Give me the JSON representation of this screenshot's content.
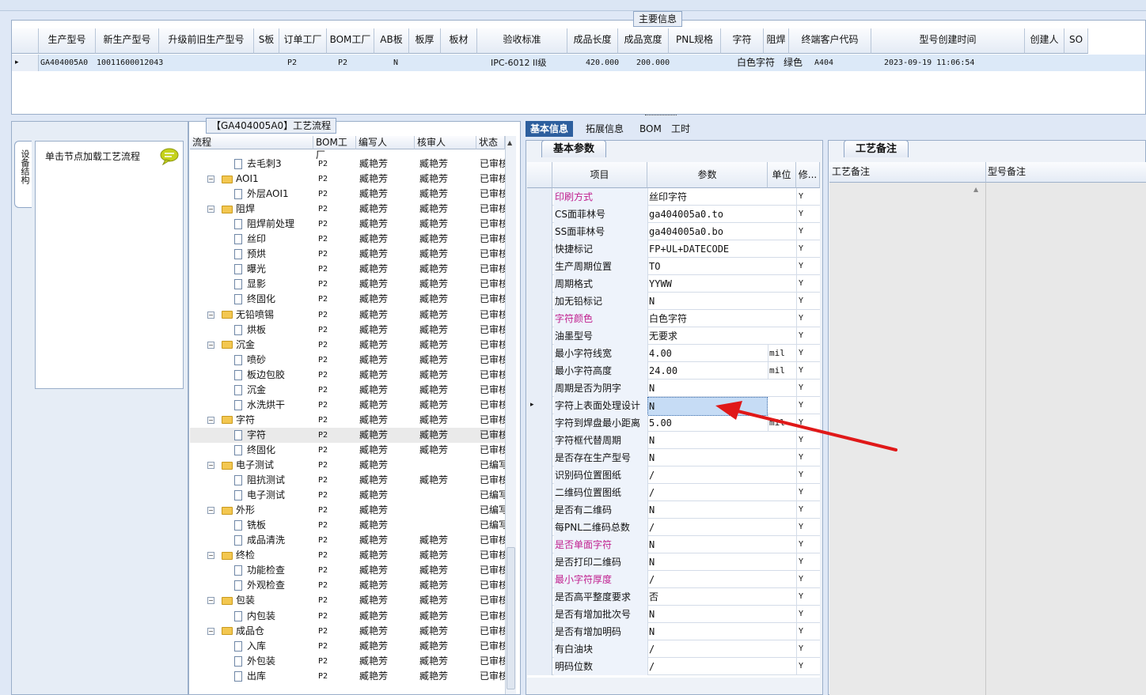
{
  "main_info": {
    "legend": "主要信息",
    "columns": [
      "生产型号",
      "新生产型号",
      "升级前旧生产型号",
      "S板",
      "订单工厂",
      "BOM工厂",
      "AB板",
      "板厚",
      "板材",
      "验收标准",
      "成品长度",
      "成品宽度",
      "PNL规格",
      "字符",
      "阻焊",
      "终端客户代码",
      "型号创建时间",
      "创建人",
      "SO"
    ],
    "row": {
      "model": "GA404005A0",
      "new_model": "10011600012043",
      "order_factory": "P2",
      "bom_factory": "P2",
      "ab_board": "N",
      "standard": "IPC-6012 II级",
      "length": "420.000",
      "width": "200.000",
      "character": "白色字符",
      "solder_mask": "绿色",
      "customer_code": "A404",
      "created": "2023-09-19 11:06:54"
    }
  },
  "left_panel": {
    "vtab_label": "设备结构",
    "hint": "单击节点加载工艺流程"
  },
  "tree": {
    "legend": "【GA404005A0】工艺流程",
    "headers": [
      "流程",
      "BOM工厂",
      "编写人",
      "核审人",
      "状态"
    ],
    "rows": [
      {
        "label": "去毛刺3",
        "level": 2,
        "bom": "P2",
        "writer": "臧艳芳",
        "reviewer": "臧艳芳",
        "status": "已审核"
      },
      {
        "label": "AOI1",
        "level": 1,
        "bom": "P2",
        "writer": "臧艳芳",
        "reviewer": "臧艳芳",
        "status": "已审核"
      },
      {
        "label": "外层AOI1",
        "level": 2,
        "bom": "P2",
        "writer": "臧艳芳",
        "reviewer": "臧艳芳",
        "status": "已审核"
      },
      {
        "label": "阻焊",
        "level": 1,
        "bom": "P2",
        "writer": "臧艳芳",
        "reviewer": "臧艳芳",
        "status": "已审核"
      },
      {
        "label": "阻焊前处理",
        "level": 2,
        "bom": "P2",
        "writer": "臧艳芳",
        "reviewer": "臧艳芳",
        "status": "已审核"
      },
      {
        "label": "丝印",
        "level": 2,
        "bom": "P2",
        "writer": "臧艳芳",
        "reviewer": "臧艳芳",
        "status": "已审核"
      },
      {
        "label": "预烘",
        "level": 2,
        "bom": "P2",
        "writer": "臧艳芳",
        "reviewer": "臧艳芳",
        "status": "已审核"
      },
      {
        "label": "曝光",
        "level": 2,
        "bom": "P2",
        "writer": "臧艳芳",
        "reviewer": "臧艳芳",
        "status": "已审核"
      },
      {
        "label": "显影",
        "level": 2,
        "bom": "P2",
        "writer": "臧艳芳",
        "reviewer": "臧艳芳",
        "status": "已审核"
      },
      {
        "label": "终固化",
        "level": 2,
        "bom": "P2",
        "writer": "臧艳芳",
        "reviewer": "臧艳芳",
        "status": "已审核"
      },
      {
        "label": "无铅喷锡",
        "level": 1,
        "bom": "P2",
        "writer": "臧艳芳",
        "reviewer": "臧艳芳",
        "status": "已审核"
      },
      {
        "label": "烘板",
        "level": 2,
        "bom": "P2",
        "writer": "臧艳芳",
        "reviewer": "臧艳芳",
        "status": "已审核"
      },
      {
        "label": "沉金",
        "level": 1,
        "bom": "P2",
        "writer": "臧艳芳",
        "reviewer": "臧艳芳",
        "status": "已审核"
      },
      {
        "label": "喷砂",
        "level": 2,
        "bom": "P2",
        "writer": "臧艳芳",
        "reviewer": "臧艳芳",
        "status": "已审核"
      },
      {
        "label": "板边包胶",
        "level": 2,
        "bom": "P2",
        "writer": "臧艳芳",
        "reviewer": "臧艳芳",
        "status": "已审核"
      },
      {
        "label": "沉金",
        "level": 2,
        "bom": "P2",
        "writer": "臧艳芳",
        "reviewer": "臧艳芳",
        "status": "已审核"
      },
      {
        "label": "水洗烘干",
        "level": 2,
        "bom": "P2",
        "writer": "臧艳芳",
        "reviewer": "臧艳芳",
        "status": "已审核"
      },
      {
        "label": "字符",
        "level": 1,
        "bom": "P2",
        "writer": "臧艳芳",
        "reviewer": "臧艳芳",
        "status": "已审核"
      },
      {
        "label": "字符",
        "level": 2,
        "bom": "P2",
        "writer": "臧艳芳",
        "reviewer": "臧艳芳",
        "status": "已审核",
        "selected": true
      },
      {
        "label": "终固化",
        "level": 2,
        "bom": "P2",
        "writer": "臧艳芳",
        "reviewer": "臧艳芳",
        "status": "已审核"
      },
      {
        "label": "电子测试",
        "level": 1,
        "bom": "P2",
        "writer": "臧艳芳",
        "reviewer": "",
        "status": "已编写"
      },
      {
        "label": "阻抗测试",
        "level": 2,
        "bom": "P2",
        "writer": "臧艳芳",
        "reviewer": "臧艳芳",
        "status": "已审核"
      },
      {
        "label": "电子测试",
        "level": 2,
        "bom": "P2",
        "writer": "臧艳芳",
        "reviewer": "",
        "status": "已编写"
      },
      {
        "label": "外形",
        "level": 1,
        "bom": "P2",
        "writer": "臧艳芳",
        "reviewer": "",
        "status": "已编写"
      },
      {
        "label": "铣板",
        "level": 2,
        "bom": "P2",
        "writer": "臧艳芳",
        "reviewer": "",
        "status": "已编写"
      },
      {
        "label": "成品清洗",
        "level": 2,
        "bom": "P2",
        "writer": "臧艳芳",
        "reviewer": "臧艳芳",
        "status": "已审核"
      },
      {
        "label": "终检",
        "level": 1,
        "bom": "P2",
        "writer": "臧艳芳",
        "reviewer": "臧艳芳",
        "status": "已审核"
      },
      {
        "label": "功能检查",
        "level": 2,
        "bom": "P2",
        "writer": "臧艳芳",
        "reviewer": "臧艳芳",
        "status": "已审核"
      },
      {
        "label": "外观检查",
        "level": 2,
        "bom": "P2",
        "writer": "臧艳芳",
        "reviewer": "臧艳芳",
        "status": "已审核"
      },
      {
        "label": "包装",
        "level": 1,
        "bom": "P2",
        "writer": "臧艳芳",
        "reviewer": "臧艳芳",
        "status": "已审核"
      },
      {
        "label": "内包装",
        "level": 2,
        "bom": "P2",
        "writer": "臧艳芳",
        "reviewer": "臧艳芳",
        "status": "已审核"
      },
      {
        "label": "成品仓",
        "level": 1,
        "bom": "P2",
        "writer": "臧艳芳",
        "reviewer": "臧艳芳",
        "status": "已审核"
      },
      {
        "label": "入库",
        "level": 2,
        "bom": "P2",
        "writer": "臧艳芳",
        "reviewer": "臧艳芳",
        "status": "已审核"
      },
      {
        "label": "外包装",
        "level": 2,
        "bom": "P2",
        "writer": "臧艳芳",
        "reviewer": "臧艳芳",
        "status": "已审核"
      },
      {
        "label": "出库",
        "level": 2,
        "bom": "P2",
        "writer": "臧艳芳",
        "reviewer": "臧艳芳",
        "status": "已审核"
      }
    ]
  },
  "tabs": [
    "基本信息",
    "拓展信息",
    "BOM",
    "工时"
  ],
  "basic": {
    "subtab": "基本参数",
    "headers": [
      "项目",
      "参数",
      "单位",
      "修..."
    ],
    "rows": [
      {
        "name": "印刷方式",
        "value": "丝印字符",
        "unit": "",
        "mod": "Y",
        "pink": true
      },
      {
        "name": "CS面菲林号",
        "value": "ga404005a0.to",
        "unit": "",
        "mod": "Y",
        "mono": true
      },
      {
        "name": "SS面菲林号",
        "value": "ga404005a0.bo",
        "unit": "",
        "mod": "Y",
        "mono": true
      },
      {
        "name": "快捷标记",
        "value": "FP+UL+DATECODE",
        "unit": "",
        "mod": "Y",
        "mono": true
      },
      {
        "name": "生产周期位置",
        "value": "TO",
        "unit": "",
        "mod": "Y",
        "mono": true
      },
      {
        "name": "周期格式",
        "value": "YYWW",
        "unit": "",
        "mod": "Y",
        "mono": true
      },
      {
        "name": "加无铅标记",
        "value": "N",
        "unit": "",
        "mod": "Y",
        "mono": true
      },
      {
        "name": "字符颜色",
        "value": "白色字符",
        "unit": "",
        "mod": "Y",
        "pink": true
      },
      {
        "name": "油墨型号",
        "value": "无要求",
        "unit": "",
        "mod": "Y"
      },
      {
        "name": "最小字符线宽",
        "value": "4.00",
        "unit": "mil",
        "mod": "Y",
        "mono": true
      },
      {
        "name": "最小字符高度",
        "value": "24.00",
        "unit": "mil",
        "mod": "Y",
        "mono": true
      },
      {
        "name": "周期是否为阴字",
        "value": "N",
        "unit": "",
        "mod": "Y",
        "mono": true
      },
      {
        "name": "字符上表面处理设计",
        "value": "N",
        "unit": "",
        "mod": "Y",
        "mono": true,
        "current": true
      },
      {
        "name": "字符到焊盘最小距离",
        "value": "5.00",
        "unit": "mil",
        "mod": "Y",
        "mono": true
      },
      {
        "name": "字符框代替周期",
        "value": "N",
        "unit": "",
        "mod": "Y",
        "mono": true
      },
      {
        "name": "是否存在生产型号",
        "value": "N",
        "unit": "",
        "mod": "Y",
        "mono": true
      },
      {
        "name": "识别码位置图纸",
        "value": "/",
        "unit": "",
        "mod": "Y",
        "mono": true
      },
      {
        "name": "二维码位置图纸",
        "value": "/",
        "unit": "",
        "mod": "Y",
        "mono": true
      },
      {
        "name": "是否有二维码",
        "value": "N",
        "unit": "",
        "mod": "Y",
        "mono": true
      },
      {
        "name": "每PNL二维码总数",
        "value": "/",
        "unit": "",
        "mod": "Y",
        "mono": true
      },
      {
        "name": "是否单面字符",
        "value": "N",
        "unit": "",
        "mod": "Y",
        "mono": true,
        "pink": true
      },
      {
        "name": "是否打印二维码",
        "value": "N",
        "unit": "",
        "mod": "Y",
        "mono": true
      },
      {
        "name": "最小字符厚度",
        "value": "/",
        "unit": "",
        "mod": "Y",
        "mono": true,
        "pink": true
      },
      {
        "name": "是否高平整度要求",
        "value": "否",
        "unit": "",
        "mod": "Y"
      },
      {
        "name": "是否有增加批次号",
        "value": "N",
        "unit": "",
        "mod": "Y",
        "mono": true
      },
      {
        "name": "是否有增加明码",
        "value": "N",
        "unit": "",
        "mod": "Y",
        "mono": true
      },
      {
        "name": "有白油块",
        "value": "/",
        "unit": "",
        "mod": "Y",
        "mono": true
      },
      {
        "name": "明码位数",
        "value": "/",
        "unit": "",
        "mod": "Y",
        "mono": true
      }
    ]
  },
  "notes": {
    "subtab": "工艺备注",
    "col1": "工艺备注",
    "col2": "型号备注"
  },
  "colors": {
    "accent": "#2d5f9e",
    "pink": "#c0208f",
    "arrow": "#e01818"
  }
}
